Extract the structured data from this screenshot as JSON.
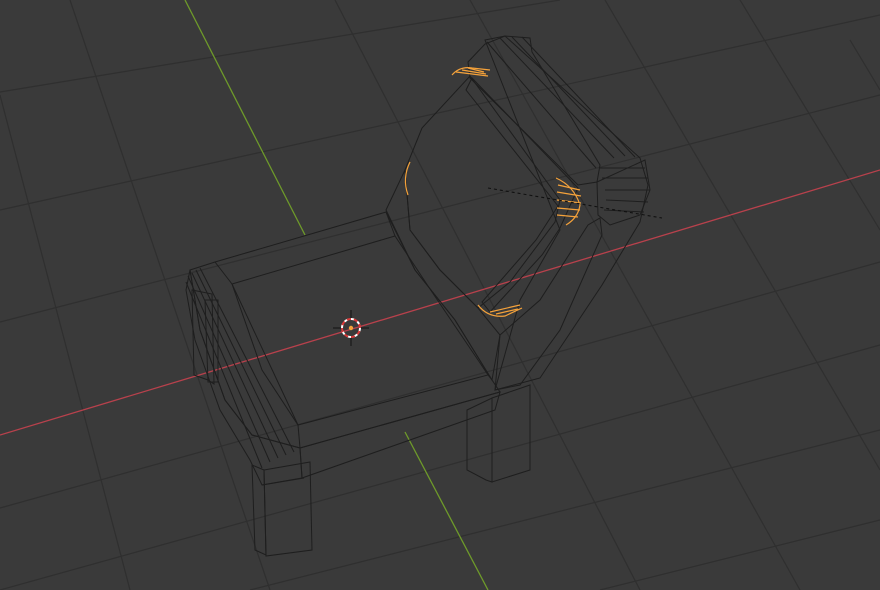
{
  "viewport": {
    "background": "#3a3a3a",
    "grid_color": "#2f2f2f",
    "x_axis_color": "#b8414c",
    "y_axis_color": "#6e9a2a",
    "mesh_face_color": "#a5a5a5",
    "mesh_edge_color": "#1e1e1e",
    "selection_color": "#f5a23a"
  },
  "scene": {
    "object": "chair-mesh",
    "selected_elements": "backrest-bevel-edges",
    "cursor": "3d-cursor"
  }
}
